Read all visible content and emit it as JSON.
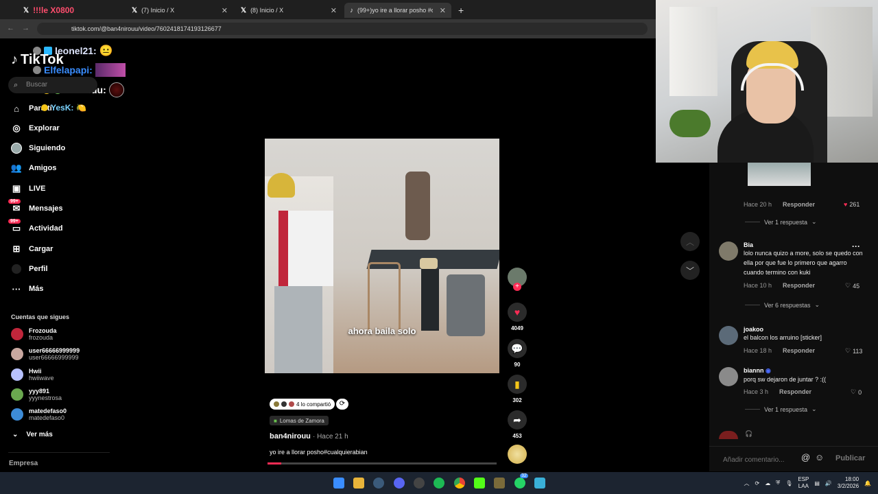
{
  "browser": {
    "tabs": [
      {
        "title": "!!!le X0800",
        "icon": "X"
      },
      {
        "title": "(7) Inicio / X",
        "icon": "X"
      },
      {
        "title": "(8) Inicio / X",
        "icon": "X"
      },
      {
        "title": "(99+)yo ire a llorar posho #cua",
        "icon": "tiktok"
      }
    ],
    "new_tab": "+",
    "url": "tiktok.com/@ban4nirouu/video/7602418174193126677"
  },
  "chat_overlay": [
    {
      "user": "leonel21:",
      "color": "#dfe6ff"
    },
    {
      "user": "Elfelapapi:",
      "color": "#3a8dff"
    },
    {
      "user": "sacksuu:",
      "color": "#ffffff"
    },
    {
      "user": "YesK:",
      "color": "#ffffff"
    }
  ],
  "sidebar": {
    "logo": "TikTok",
    "search_placeholder": "Buscar",
    "items": [
      {
        "label": "Para ti",
        "icon": "home-icon",
        "badge": ""
      },
      {
        "label": "Explorar",
        "icon": "compass-icon",
        "badge": ""
      },
      {
        "label": "Siguiendo",
        "icon": "following-icon",
        "badge": ""
      },
      {
        "label": "Amigos",
        "icon": "friends-icon",
        "badge": ""
      },
      {
        "label": "LIVE",
        "icon": "live-icon",
        "badge": ""
      },
      {
        "label": "Mensajes",
        "icon": "messages-icon",
        "badge": "99+"
      },
      {
        "label": "Actividad",
        "icon": "activity-icon",
        "badge": "99+"
      },
      {
        "label": "Cargar",
        "icon": "upload-icon",
        "badge": ""
      },
      {
        "label": "Perfil",
        "icon": "profile-icon",
        "badge": ""
      },
      {
        "label": "Más",
        "icon": "more-icon",
        "badge": ""
      }
    ],
    "following_header": "Cuentas que sigues",
    "following": [
      {
        "name": "Frozouda",
        "handle": "frozouda",
        "color": "#c0263b"
      },
      {
        "name": "user66666999999",
        "handle": "user66666999999",
        "color": "#c9a8a0"
      },
      {
        "name": "Hwii",
        "handle": "hwiiwave",
        "color": "#b7c1ff"
      },
      {
        "name": "yyy891",
        "handle": "yyynestrosa",
        "color": "#6aa84f"
      },
      {
        "name": "matedefaso0",
        "handle": "matedefaso0",
        "color": "#3d8bd6"
      }
    ],
    "see_more": "Ver más",
    "footer": "Empresa"
  },
  "video": {
    "overlay_text": "ahora baila solo",
    "shared_text": "4 lo compartió",
    "location": "Lomas de Zamora",
    "author": "ban4nirouu",
    "time": "Hace 21 h",
    "description": "yo ire a llorar posho#cualquierabian",
    "progress": 0.06,
    "actions": {
      "likes": "4049",
      "comments": "90",
      "saves": "302",
      "shares": "453"
    }
  },
  "comments": {
    "first_meta": {
      "time": "Hace 20 h",
      "reply": "Responder",
      "likes": "261"
    },
    "first_view_replies": "Ver 1 respuesta",
    "items": [
      {
        "user": "Bia",
        "text": "lolo nunca quizo a more, solo se quedo con ella por que fue lo primero que agarro cuando termino con kuki",
        "time": "Hace 10 h",
        "reply": "Responder",
        "likes": "45",
        "view_replies": "Ver 6 respuestas"
      },
      {
        "user": "joakoo",
        "text": "el balcon los arruino [sticker]",
        "time": "Hace 18 h",
        "reply": "Responder",
        "likes": "113",
        "view_replies": ""
      },
      {
        "user": "biannn",
        "text": "porq sw dejaron de juntar ? :((",
        "time": "Hace 3 h",
        "reply": "Responder",
        "likes": "0",
        "view_replies": "Ver 1 respuesta"
      }
    ],
    "input_placeholder": "Añadir comentario...",
    "post_label": "Publicar"
  },
  "taskbar": {
    "lang": "ESP",
    "lang2": "LAA",
    "time": "18:00",
    "date": "3/2/2026",
    "whatsapp_badge": "32"
  }
}
